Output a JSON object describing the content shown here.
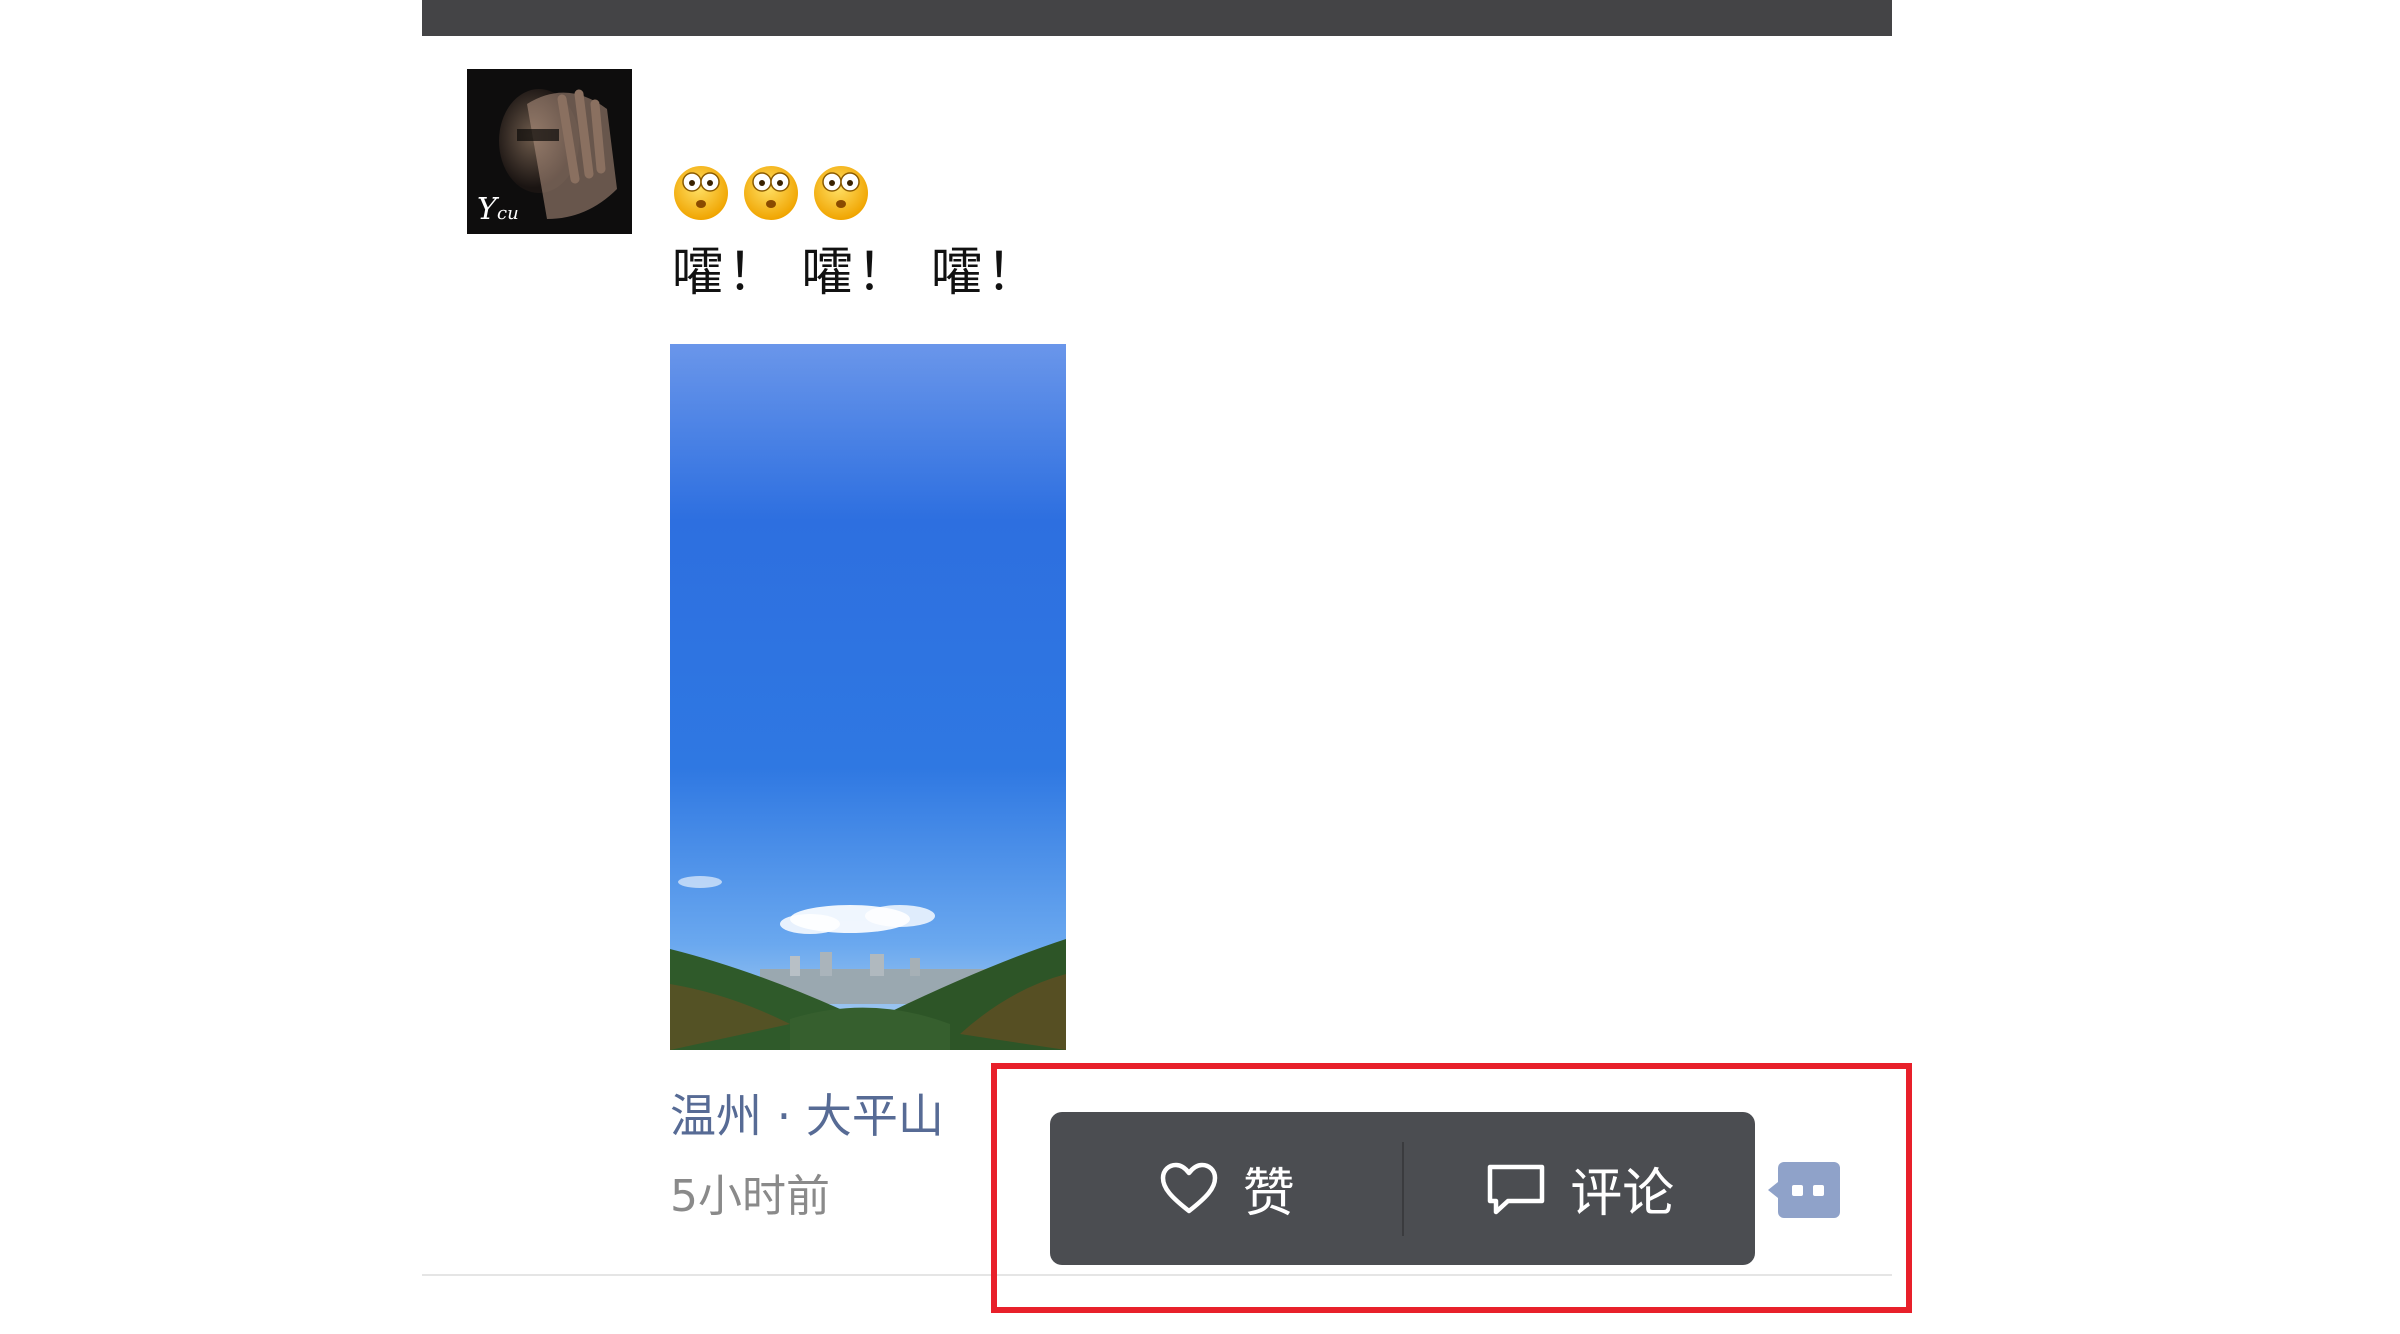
{
  "post": {
    "text": "嚯！ 嚯！ 嚯！",
    "location": "温州 · 大平山",
    "time": "5小时前"
  },
  "actions": {
    "like_label": "赞",
    "comment_label": "评论"
  },
  "colors": {
    "link": "#576b95",
    "popup_bg": "#4b4d51",
    "highlight": "#e8202a",
    "more_button": "#8fa2c9"
  },
  "icons": {
    "emoji": "flushed-face-icon",
    "like": "heart-icon",
    "comment": "speech-bubble-icon",
    "more": "more-dots-icon"
  }
}
